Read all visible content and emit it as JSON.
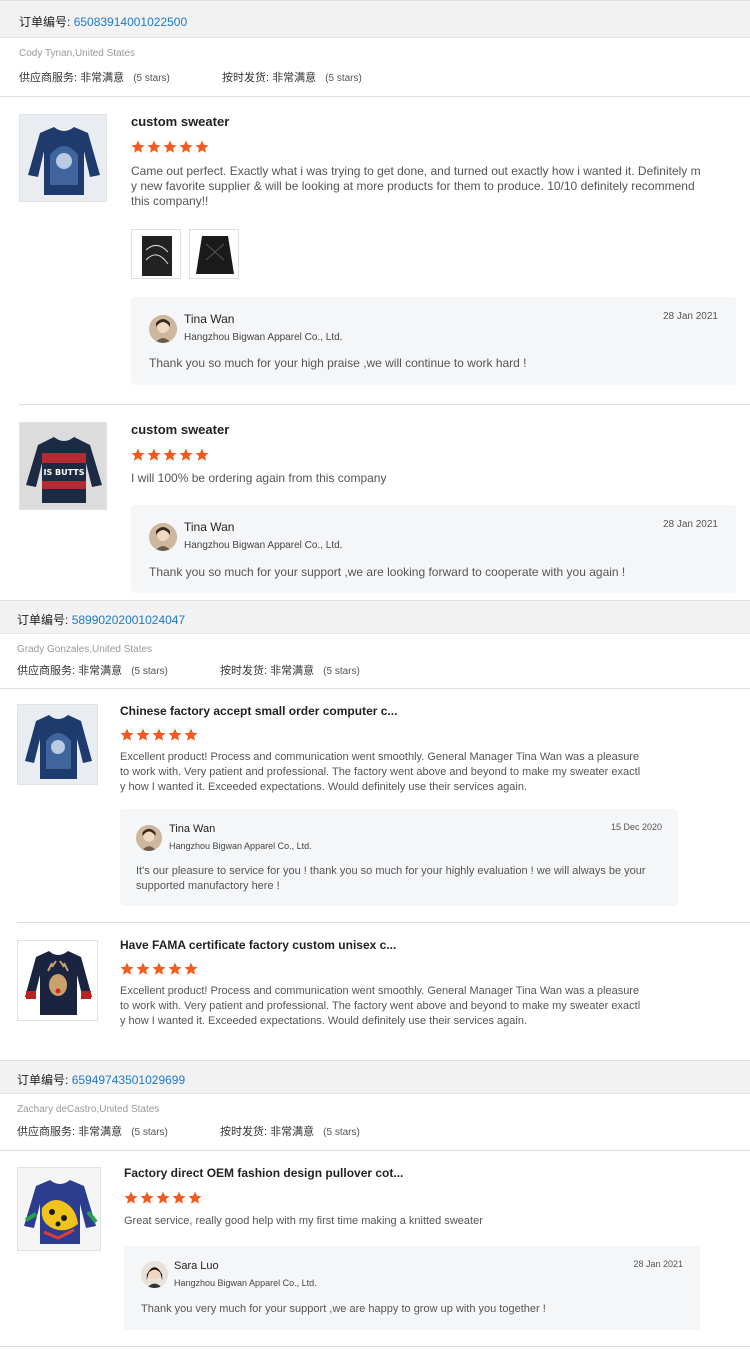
{
  "order_label": "订单编号:",
  "service_label": "供应商服务:",
  "shipping_label": "按时发货:",
  "rating_text": "非常满意",
  "stars_text": "(5 stars)",
  "star_color": "#f4591e",
  "link_color": "#1e79c6",
  "orders": [
    {
      "order_number": "65083914001022500",
      "buyer": "Cody Tynan,United States",
      "items": [
        {
          "title": "custom sweater",
          "rating": 5,
          "review": "Came out perfect. Exactly what i was trying to get done, and turned out exactly how i wanted it. Definitely m\ny new favorite supplier & will be looking at more products for them to produce. 10/10 definitely recommend\nthis company!!",
          "reply": {
            "name": "Tina Wan",
            "company": "Hangzhou Bigwan Apparel Co., Ltd.",
            "date": "28 Jan 2021",
            "message": "Thank you so much for your high praise ,we will continue to work hard !"
          }
        },
        {
          "title": "custom sweater",
          "rating": 5,
          "review": "I will 100% be ordering again from this company",
          "thumb_text": "IS BUTTS",
          "reply": {
            "name": "Tina Wan",
            "company": "Hangzhou Bigwan Apparel Co., Ltd.",
            "date": "28 Jan 2021",
            "message": "Thank you so much for your support  ,we are looking forward to  cooperate with you again !"
          }
        }
      ]
    },
    {
      "order_number": "58990202001024047",
      "buyer": "Grady Gonzales,United States",
      "items": [
        {
          "title": "Chinese factory accept small order computer c...",
          "rating": 5,
          "review": "Excellent product! Process and communication went smoothly. General Manager Tina Wan was a pleasure\nto work with. Very patient and professional. The factory went above and beyond to make my sweater exactl\ny how I wanted it. Exceeded expectations. Would definitely use their services again.",
          "reply": {
            "name": "Tina Wan",
            "company": "Hangzhou Bigwan Apparel Co., Ltd.",
            "date": "15 Dec 2020",
            "message": "It's our pleasure to service for you ! thank you so much for your highly evaluation !  we will always be your\nsupported  manufactory here !"
          }
        },
        {
          "title": "Have FAMA certificate factory custom unisex c...",
          "rating": 5,
          "review": "Excellent product! Process and communication went smoothly. General Manager Tina Wan was a pleasure\nto work with. Very patient and professional. The factory went above and beyond to make my sweater exactl\ny how I wanted it. Exceeded expectations. Would definitely use their services again."
        }
      ]
    },
    {
      "order_number": "65949743501029699",
      "buyer": "Zachary deCastro,United States",
      "items": [
        {
          "title": "Factory direct OEM fashion design pullover cot...",
          "rating": 5,
          "review": "Great service, really good help with my first time making a knitted sweater",
          "reply": {
            "name": "Sara Luo",
            "company": "Hangzhou Bigwan Apparel Co., Ltd.",
            "date": "28 Jan 2021",
            "message": "Thank you very much for your support ,we are happy to grow up with you together !"
          }
        }
      ]
    }
  ]
}
